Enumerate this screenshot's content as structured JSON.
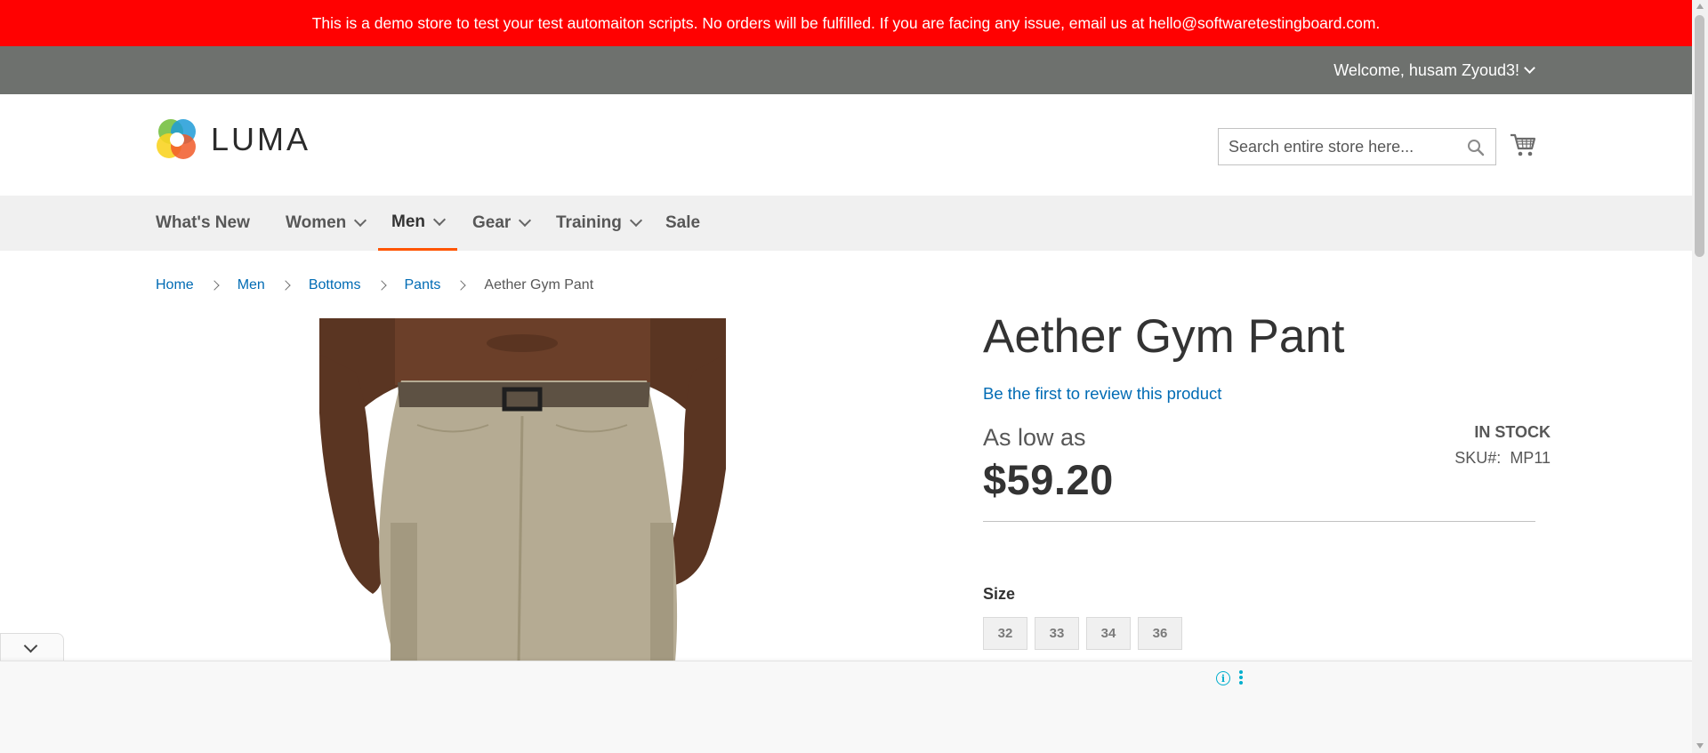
{
  "banner": {
    "text": "This is a demo store to test your test automaiton scripts. No orders will be fulfilled. If you are facing any issue, email us at hello@softwaretestingboard.com."
  },
  "account": {
    "welcome": "Welcome, husam Zyoud3!"
  },
  "header": {
    "logo_text": "LUMA",
    "search_placeholder": "Search entire store here...",
    "search_icon": "search-icon",
    "cart_icon": "cart-icon"
  },
  "nav": {
    "items": [
      {
        "label": "What's New",
        "has_dropdown": false,
        "active": false
      },
      {
        "label": "Women",
        "has_dropdown": true,
        "active": false
      },
      {
        "label": "Men",
        "has_dropdown": true,
        "active": true
      },
      {
        "label": "Gear",
        "has_dropdown": true,
        "active": false
      },
      {
        "label": "Training",
        "has_dropdown": true,
        "active": false
      },
      {
        "label": "Sale",
        "has_dropdown": false,
        "active": false
      }
    ]
  },
  "breadcrumb": {
    "links": [
      "Home",
      "Men",
      "Bottoms",
      "Pants"
    ],
    "current": "Aether Gym Pant"
  },
  "product": {
    "title": "Aether Gym Pant",
    "review_link": "Be the first to review this product",
    "price_prefix": "As low as",
    "price": "$59.20",
    "stock_status": "IN STOCK",
    "sku_label": "SKU#:",
    "sku_value": "MP11",
    "size_label": "Size",
    "sizes": [
      "32",
      "33",
      "34",
      "36"
    ]
  },
  "ad": {
    "info_icon": "info-icon",
    "menu_icon": "kebab-menu-icon"
  },
  "colors": {
    "banner_bg": "#ff0101",
    "welcome_bar_bg": "#6e716e",
    "nav_bg": "#f0f0f0",
    "active_underline": "#ff5501",
    "link": "#006bb4"
  }
}
